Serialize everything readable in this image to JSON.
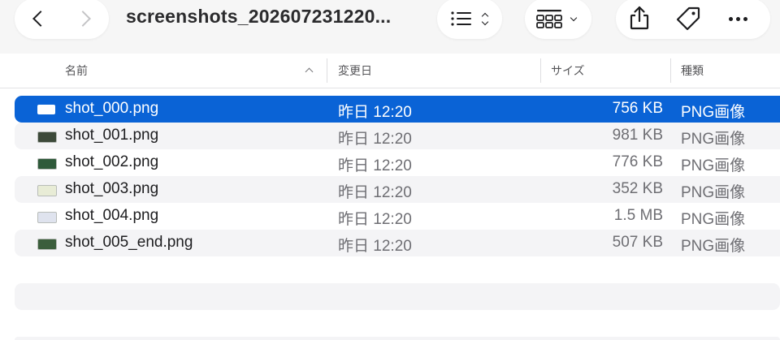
{
  "toolbar": {
    "title": "screenshots_202607231220...",
    "buttons": {
      "back_icon": "chevron-left-icon",
      "forward_icon": "chevron-right-icon",
      "list_view_icon": "list-view-icon",
      "grid_view_icon": "grid-view-icon",
      "share_icon": "share-icon",
      "tag_icon": "tag-icon",
      "more_icon": "more-icon"
    }
  },
  "columns": {
    "name": "名前",
    "modified": "変更日",
    "size": "サイズ",
    "kind": "種類"
  },
  "files": [
    {
      "name": "shot_000.png",
      "date": "昨日 12:20",
      "size": "756 KB",
      "kind": "PNG画像",
      "selected": true,
      "thumb_color": "#ffffff"
    },
    {
      "name": "shot_001.png",
      "date": "昨日 12:20",
      "size": "981 KB",
      "kind": "PNG画像",
      "selected": false,
      "thumb_color": "#3d4a3a"
    },
    {
      "name": "shot_002.png",
      "date": "昨日 12:20",
      "size": "776 KB",
      "kind": "PNG画像",
      "selected": false,
      "thumb_color": "#2f5a3a"
    },
    {
      "name": "shot_003.png",
      "date": "昨日 12:20",
      "size": "352 KB",
      "kind": "PNG画像",
      "selected": false,
      "thumb_color": "#e8ecd6"
    },
    {
      "name": "shot_004.png",
      "date": "昨日 12:20",
      "size": "1.5 MB",
      "kind": "PNG画像",
      "selected": false,
      "thumb_color": "#dfe3ee"
    },
    {
      "name": "shot_005_end.png",
      "date": "昨日 12:20",
      "size": "507 KB",
      "kind": "PNG画像",
      "selected": false,
      "thumb_color": "#3b5e3c"
    }
  ],
  "colors": {
    "selection": "#0a63d6",
    "alt_row": "#f4f4f6"
  }
}
